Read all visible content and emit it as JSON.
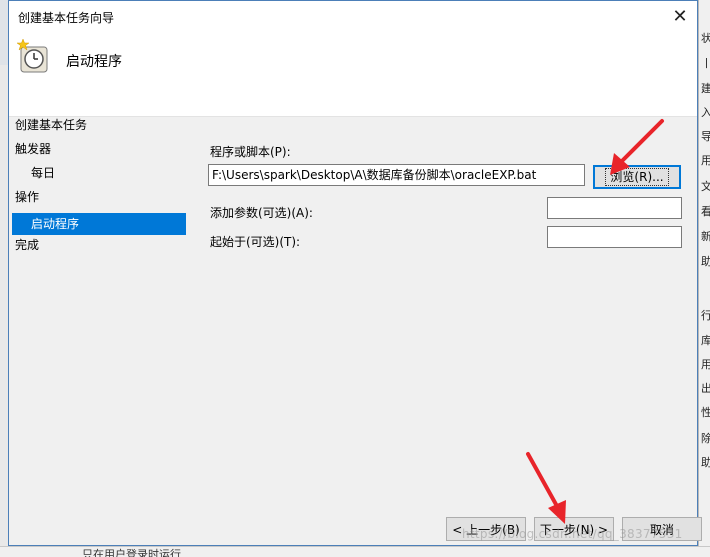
{
  "dialog": {
    "title": "创建基本任务向导",
    "heading": "启动程序",
    "close_glyph": "✕"
  },
  "nav": {
    "items": [
      {
        "label": "创建基本任务"
      },
      {
        "label": "触发器"
      },
      {
        "label": "每日"
      },
      {
        "label": "操作"
      },
      {
        "label": "启动程序"
      },
      {
        "label": "完成"
      }
    ]
  },
  "form": {
    "program_label": "程序或脚本(P):",
    "program_value": "F:\\Users\\spark\\Desktop\\A\\数据库备份脚本\\oracleEXP.bat",
    "browse_label": "浏览(R)...",
    "args_label": "添加参数(可选)(A):",
    "args_value": "",
    "start_in_label": "起始于(可选)(T):",
    "start_in_value": ""
  },
  "footer": {
    "back_label": "< 上一步(B)",
    "next_label": "下一步(N) >",
    "cancel_label": "取消"
  },
  "background": {
    "right_chars": [
      "状",
      "丨",
      "建",
      "入",
      "导",
      "用",
      "文",
      "看",
      "新",
      "助",
      "行",
      "库",
      "用",
      "出",
      "性",
      "除",
      "助"
    ],
    "bottom_text": "只在用户登录时运行"
  },
  "watermark": "https://blog.csdn.net/qq_38377531",
  "colors": {
    "accent": "#0078d7",
    "arrow": "#e8242a"
  }
}
